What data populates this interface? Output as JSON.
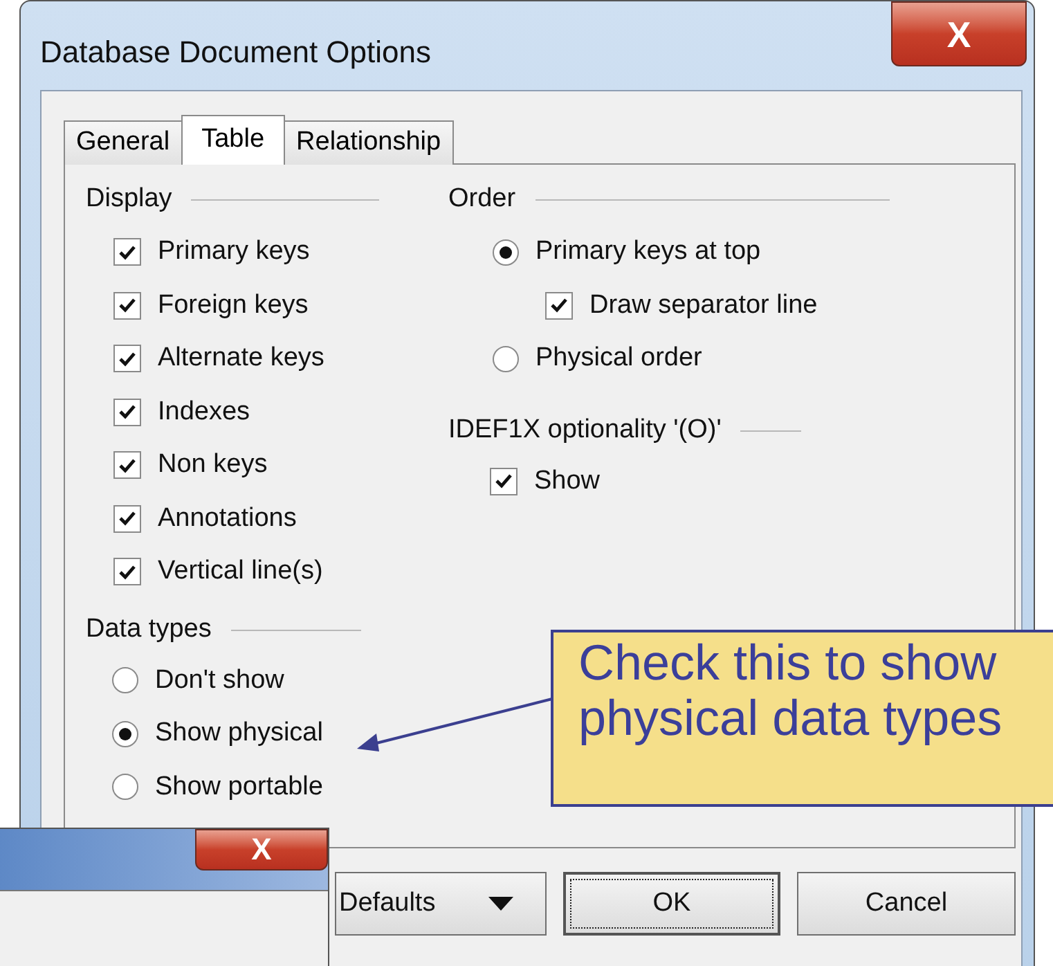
{
  "window": {
    "title": "Database Document Options",
    "close": "X"
  },
  "tabs": [
    {
      "label": "General",
      "selected": false
    },
    {
      "label": "Table",
      "selected": true
    },
    {
      "label": "Relationship",
      "selected": false
    }
  ],
  "display": {
    "title": "Display",
    "items": [
      {
        "label": "Primary keys",
        "checked": true
      },
      {
        "label": "Foreign keys",
        "checked": true
      },
      {
        "label": "Alternate keys",
        "checked": true
      },
      {
        "label": "Indexes",
        "checked": true
      },
      {
        "label": "Non keys",
        "checked": true
      },
      {
        "label": "Annotations",
        "checked": true
      },
      {
        "label": "Vertical line(s)",
        "checked": true
      }
    ]
  },
  "data_types": {
    "title": "Data types",
    "options": [
      {
        "label": "Don't show",
        "selected": false
      },
      {
        "label": "Show physical",
        "selected": true
      },
      {
        "label": "Show portable",
        "selected": false
      }
    ]
  },
  "order": {
    "title": "Order",
    "options": [
      {
        "label": "Primary keys at top",
        "selected": true,
        "sub_option": {
          "label": "Draw separator line",
          "checked": true
        }
      },
      {
        "label": "Physical order",
        "selected": false
      }
    ]
  },
  "optionality": {
    "title": "IDEF1X optionality '(O)'",
    "items": [
      {
        "label": "Show",
        "checked": true
      }
    ]
  },
  "buttons": [
    {
      "label": "Defaults",
      "kind": "menu"
    },
    {
      "label": "OK",
      "kind": "default"
    },
    {
      "label": "Cancel",
      "kind": "plain"
    }
  ],
  "callout": {
    "lines": [
      "Check this to show",
      "physical data types"
    ]
  },
  "background_window": {
    "close": "X"
  }
}
